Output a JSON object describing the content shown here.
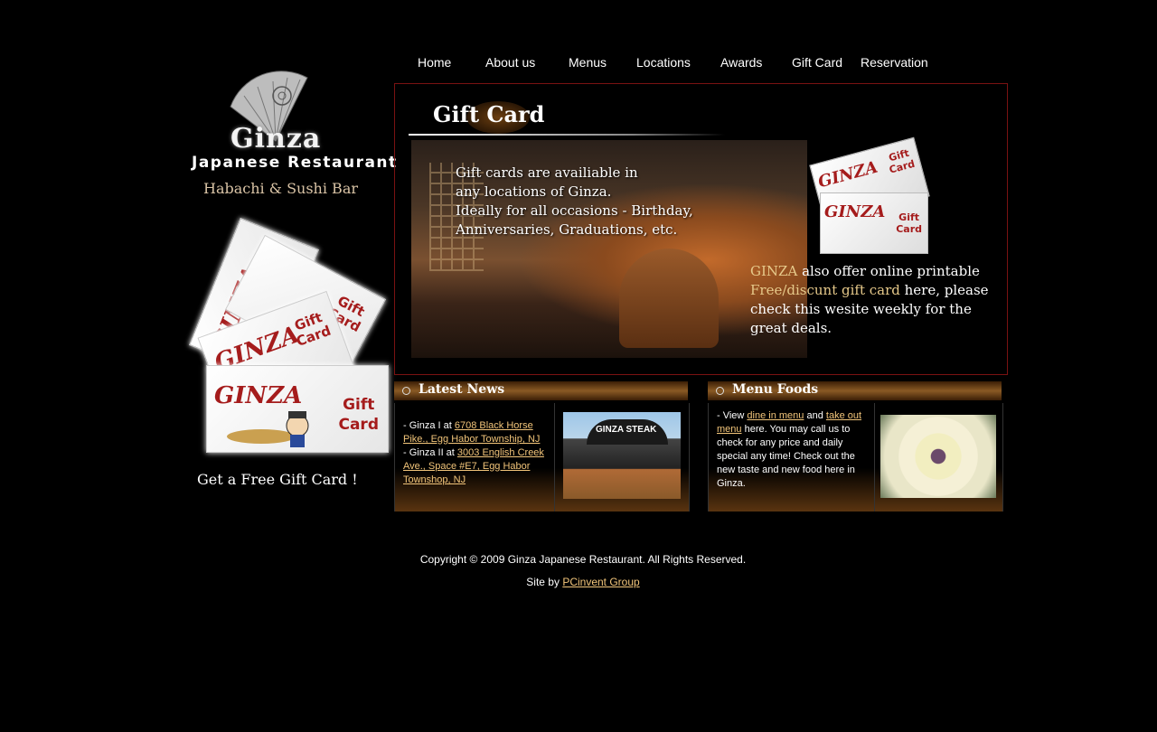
{
  "nav": [
    {
      "label": "Home"
    },
    {
      "label": "About us"
    },
    {
      "label": "Menus"
    },
    {
      "label": "Locations"
    },
    {
      "label": "Awards"
    },
    {
      "label": "Gift Card"
    },
    {
      "label": "Reservation"
    }
  ],
  "brand": {
    "name": "Ginza",
    "subtitle": "Japanese Restaurant",
    "tagline": "Habachi & Sushi Bar"
  },
  "gift_card": {
    "logo_text": "GINZA",
    "card_text_line1": "Gift",
    "card_text_line2": "Card",
    "cta": "Get a Free Gift Card !"
  },
  "main": {
    "title": "Gift Card",
    "photo_text": [
      "Gift cards are availiable in",
      "any locations of Ginza.",
      "Ideally for all occasions - Birthday,",
      "Anniversaries, Graduations, etc."
    ],
    "offer_brand": "GINZA",
    "offer_text_1": " also offer online printable",
    "offer_highlight": "Free/discunt gift card",
    "offer_text_2": " here, please check this wesite weekly for the great deals."
  },
  "news": {
    "heading": "Latest News",
    "item1_prefix": "- Ginza I at ",
    "item1_link": "6708 Black Horse Pike., Egg Habor Township, NJ",
    "item2_prefix": "- Ginza II at ",
    "item2_link": "3003 English Creek Ave., Space #E7, Egg Habor Townshop, NJ",
    "thumb_sign": "GINZA STEAK"
  },
  "foods": {
    "heading": "Menu Foods",
    "t1": "- View ",
    "link1": "dine in menu",
    "t2": " and ",
    "link2": "take out menu",
    "t3": " here. You may call us to check for any price and daily special any time! Check out the new taste and new food here in Ginza."
  },
  "footer": {
    "copyright": "Copyright © 2009 Ginza Japanese Restaurant. All Rights Reserved.",
    "site_by_prefix": "Site by ",
    "site_by_link": "PCinvent Group"
  },
  "colors": {
    "background": "#000000",
    "panel_border": "#7a1212",
    "link": "#f2c57a",
    "card_red": "#a51c1c"
  }
}
